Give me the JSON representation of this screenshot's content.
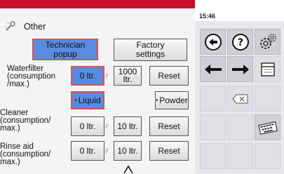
{
  "header": {
    "section_title": "Other",
    "time": "15:46"
  },
  "buttons": {
    "technician_popup": "Technician\npopup",
    "factory_settings": "Factory\nsettings"
  },
  "waterfilter": {
    "label": "Waterfilter\n(consumption\n/max.)",
    "consumption": "0 ltr.",
    "max": "1000\nltr.",
    "reset": "Reset"
  },
  "mode": {
    "liquid": "Liquid",
    "powder": "Powder"
  },
  "cleaner": {
    "label": "Cleaner\n(consumption/\nmax.)",
    "consumption": "0 ltr.",
    "max": "10 ltr.",
    "reset": "Reset"
  },
  "rinse_aid": {
    "label": "Rinse aid\n(consumption/\nmax.)",
    "consumption": "0 ltr.",
    "max": "10 ltr.",
    "reset": "Reset"
  },
  "separator": "/",
  "icons": {
    "back": "back-arrow-circle-icon",
    "help": "question-circle-icon",
    "settings": "gears-icon",
    "left": "arrow-left-icon",
    "right": "arrow-right-icon",
    "window": "window-icon",
    "backspace": "backspace-icon",
    "keyboard": "keyboard-icon"
  },
  "colors": {
    "accent_red": "#c8102e",
    "selected_blue": "#5a8be0"
  }
}
